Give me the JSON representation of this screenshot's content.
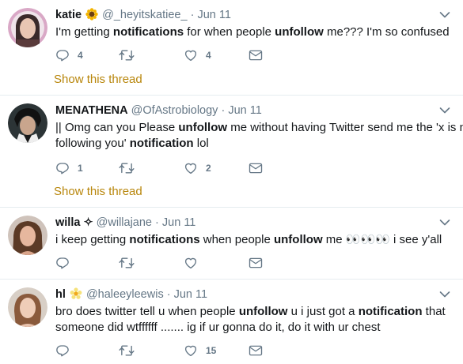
{
  "colors": {
    "text": "#14171a",
    "muted": "#657786",
    "thread_link": "#b8860b",
    "divider": "#e6ecf0"
  },
  "tweets": [
    {
      "name": "katie",
      "badge_icon": "sunflower-icon",
      "handle": "@_heyitskatiee_",
      "sep": "·",
      "date": "Jun 11",
      "text": [
        [
          {
            "t": "I'm getting "
          },
          {
            "t": "notifications",
            "b": true
          },
          {
            "t": " for when people "
          },
          {
            "t": "unfollow",
            "b": true
          },
          {
            "t": " me??? I'm so confused"
          }
        ]
      ],
      "reply_count": "4",
      "retweet_count": "",
      "like_count": "4",
      "show_thread": "Show this thread"
    },
    {
      "name": "MENATHENA",
      "handle": "@OfAstrobiology",
      "sep": "·",
      "date": "Jun 11",
      "text": [
        [
          {
            "t": "|| Omg can you Please "
          },
          {
            "t": "unfollow",
            "b": true
          },
          {
            "t": " me without having Twitter send me the 'x is now"
          }
        ],
        [
          {
            "t": "following you' "
          },
          {
            "t": "notification",
            "b": true
          },
          {
            "t": " lol"
          }
        ]
      ],
      "reply_count": "1",
      "retweet_count": "",
      "like_count": "2",
      "show_thread": "Show this thread"
    },
    {
      "name": "willa",
      "name_suffix": "✧",
      "handle": "@willajane",
      "sep": "·",
      "date": "Jun 11",
      "text": [
        [
          {
            "t": "i keep getting "
          },
          {
            "t": "notifications",
            "b": true
          },
          {
            "t": " when people "
          },
          {
            "t": "unfollow",
            "b": true
          },
          {
            "t": " me "
          },
          {
            "t": "👀👀👀",
            "e": true
          },
          {
            "t": " i see y'all"
          }
        ]
      ],
      "reply_count": "",
      "retweet_count": "",
      "like_count": ""
    },
    {
      "name": "hl",
      "badge_icon": "blossom-icon",
      "handle": "@haleeyleewis",
      "sep": "·",
      "date": "Jun 11",
      "text": [
        [
          {
            "t": "bro does twitter tell u when people "
          },
          {
            "t": "unfollow",
            "b": true
          },
          {
            "t": " u i just got a "
          },
          {
            "t": "notification",
            "b": true
          },
          {
            "t": " that"
          }
        ],
        [
          {
            "t": "someone did wtffffff ....... ig if ur gonna do it, do it with ur chest"
          }
        ]
      ],
      "reply_count": "",
      "retweet_count": "",
      "like_count": "15"
    }
  ]
}
